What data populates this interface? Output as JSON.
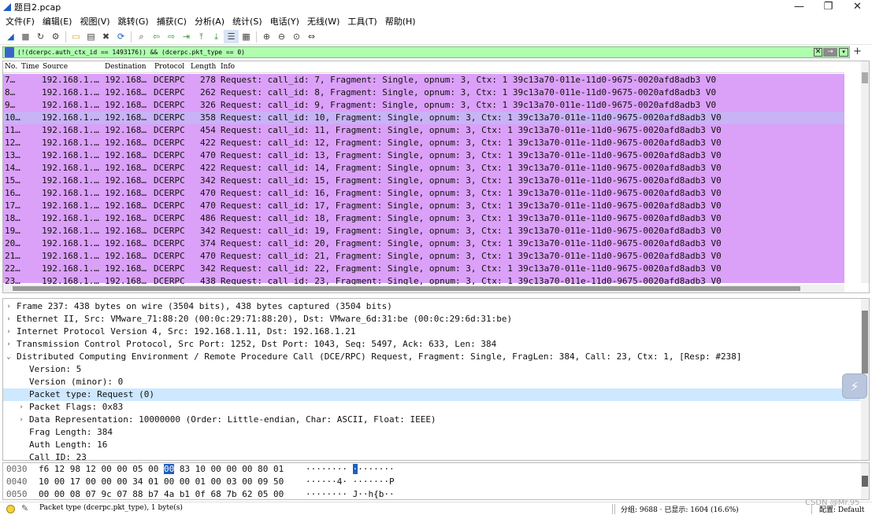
{
  "window": {
    "title": "题目2.pcap",
    "minimize_glyph": "—",
    "restore_glyph": "❐",
    "close_glyph": "✕"
  },
  "menu": [
    "文件(F)",
    "编辑(E)",
    "视图(V)",
    "跳转(G)",
    "捕获(C)",
    "分析(A)",
    "统计(S)",
    "电话(Y)",
    "无线(W)",
    "工具(T)",
    "帮助(H)"
  ],
  "toolbar_icons": [
    {
      "name": "shark-fin-start-icon",
      "glyph": "◢"
    },
    {
      "name": "stop-capture-icon",
      "glyph": "■"
    },
    {
      "name": "restart-capture-icon",
      "glyph": "↻"
    },
    {
      "name": "capture-options-icon",
      "glyph": "⚙"
    },
    {
      "name": "open-file-icon",
      "glyph": "▭"
    },
    {
      "name": "save-file-icon",
      "glyph": "▤"
    },
    {
      "name": "close-file-icon",
      "glyph": "✖"
    },
    {
      "name": "reload-file-icon",
      "glyph": "⟳"
    },
    {
      "name": "find-packet-icon",
      "glyph": "⌕"
    },
    {
      "name": "go-back-icon",
      "glyph": "⇦"
    },
    {
      "name": "go-forward-icon",
      "glyph": "⇨"
    },
    {
      "name": "go-to-packet-icon",
      "glyph": "⇥"
    },
    {
      "name": "go-first-icon",
      "glyph": "⤒"
    },
    {
      "name": "go-last-icon",
      "glyph": "⤓"
    },
    {
      "name": "auto-scroll-icon",
      "glyph": "☰"
    },
    {
      "name": "colorize-icon",
      "glyph": "▦"
    },
    {
      "name": "zoom-in-icon",
      "glyph": "⊕"
    },
    {
      "name": "zoom-out-icon",
      "glyph": "⊖"
    },
    {
      "name": "zoom-normal-icon",
      "glyph": "⊙"
    },
    {
      "name": "resize-columns-icon",
      "glyph": "⇔"
    }
  ],
  "filter": {
    "text": "(!(dcerpc.auth_ctx_id == 1493176)) && (dcerpc.pkt_type == 0)",
    "clear_glyph": "✕",
    "apply_glyph": "→",
    "dropdown_glyph": "▾",
    "add_glyph": "+"
  },
  "packet_list": {
    "columns": [
      "No.",
      "Time",
      "Source",
      "Destination",
      "Protocol",
      "Length",
      "Info"
    ],
    "rows": [
      {
        "no": "7…",
        "src": "192.168.1.…",
        "dst": "192.168…",
        "proto": "DCERPC",
        "len": "278",
        "info": "Request: call_id: 7, Fragment: Single, opnum: 3, Ctx: 1 39c13a70-011e-11d0-9675-0020afd8adb3 V0"
      },
      {
        "no": "8…",
        "src": "192.168.1.…",
        "dst": "192.168…",
        "proto": "DCERPC",
        "len": "262",
        "info": "Request: call_id: 8, Fragment: Single, opnum: 3, Ctx: 1 39c13a70-011e-11d0-9675-0020afd8adb3 V0"
      },
      {
        "no": "9…",
        "src": "192.168.1.…",
        "dst": "192.168…",
        "proto": "DCERPC",
        "len": "326",
        "info": "Request: call_id: 9, Fragment: Single, opnum: 3, Ctx: 1 39c13a70-011e-11d0-9675-0020afd8adb3 V0"
      },
      {
        "no": "10…",
        "src": "192.168.1.…",
        "dst": "192.168…",
        "proto": "DCERPC",
        "len": "358",
        "info": "Request: call_id: 10, Fragment: Single, opnum: 3, Ctx: 1 39c13a70-011e-11d0-9675-0020afd8adb3 V0"
      },
      {
        "no": "11…",
        "src": "192.168.1.…",
        "dst": "192.168…",
        "proto": "DCERPC",
        "len": "454",
        "info": "Request: call_id: 11, Fragment: Single, opnum: 3, Ctx: 1 39c13a70-011e-11d0-9675-0020afd8adb3 V0"
      },
      {
        "no": "12…",
        "src": "192.168.1.…",
        "dst": "192.168…",
        "proto": "DCERPC",
        "len": "422",
        "info": "Request: call_id: 12, Fragment: Single, opnum: 3, Ctx: 1 39c13a70-011e-11d0-9675-0020afd8adb3 V0"
      },
      {
        "no": "13…",
        "src": "192.168.1.…",
        "dst": "192.168…",
        "proto": "DCERPC",
        "len": "470",
        "info": "Request: call_id: 13, Fragment: Single, opnum: 3, Ctx: 1 39c13a70-011e-11d0-9675-0020afd8adb3 V0"
      },
      {
        "no": "14…",
        "src": "192.168.1.…",
        "dst": "192.168…",
        "proto": "DCERPC",
        "len": "422",
        "info": "Request: call_id: 14, Fragment: Single, opnum: 3, Ctx: 1 39c13a70-011e-11d0-9675-0020afd8adb3 V0"
      },
      {
        "no": "15…",
        "src": "192.168.1.…",
        "dst": "192.168…",
        "proto": "DCERPC",
        "len": "342",
        "info": "Request: call_id: 15, Fragment: Single, opnum: 3, Ctx: 1 39c13a70-011e-11d0-9675-0020afd8adb3 V0"
      },
      {
        "no": "16…",
        "src": "192.168.1.…",
        "dst": "192.168…",
        "proto": "DCERPC",
        "len": "470",
        "info": "Request: call_id: 16, Fragment: Single, opnum: 3, Ctx: 1 39c13a70-011e-11d0-9675-0020afd8adb3 V0"
      },
      {
        "no": "17…",
        "src": "192.168.1.…",
        "dst": "192.168…",
        "proto": "DCERPC",
        "len": "470",
        "info": "Request: call_id: 17, Fragment: Single, opnum: 3, Ctx: 1 39c13a70-011e-11d0-9675-0020afd8adb3 V0"
      },
      {
        "no": "18…",
        "src": "192.168.1.…",
        "dst": "192.168…",
        "proto": "DCERPC",
        "len": "486",
        "info": "Request: call_id: 18, Fragment: Single, opnum: 3, Ctx: 1 39c13a70-011e-11d0-9675-0020afd8adb3 V0"
      },
      {
        "no": "19…",
        "src": "192.168.1.…",
        "dst": "192.168…",
        "proto": "DCERPC",
        "len": "342",
        "info": "Request: call_id: 19, Fragment: Single, opnum: 3, Ctx: 1 39c13a70-011e-11d0-9675-0020afd8adb3 V0"
      },
      {
        "no": "20…",
        "src": "192.168.1.…",
        "dst": "192.168…",
        "proto": "DCERPC",
        "len": "374",
        "info": "Request: call_id: 20, Fragment: Single, opnum: 3, Ctx: 1 39c13a70-011e-11d0-9675-0020afd8adb3 V0"
      },
      {
        "no": "21…",
        "src": "192.168.1.…",
        "dst": "192.168…",
        "proto": "DCERPC",
        "len": "470",
        "info": "Request: call_id: 21, Fragment: Single, opnum: 3, Ctx: 1 39c13a70-011e-11d0-9675-0020afd8adb3 V0"
      },
      {
        "no": "22…",
        "src": "192.168.1.…",
        "dst": "192.168…",
        "proto": "DCERPC",
        "len": "342",
        "info": "Request: call_id: 22, Fragment: Single, opnum: 3, Ctx: 1 39c13a70-011e-11d0-9675-0020afd8adb3 V0"
      },
      {
        "no": "23…",
        "src": "192.168.1.…",
        "dst": "192.168…",
        "proto": "DCERPC",
        "len": "438",
        "info": "Request: call_id: 23, Fragment: Single, opnum: 3, Ctx: 1 39c13a70-011e-11d0-9675-0020afd8adb3 V0"
      }
    ],
    "selected_index": 3,
    "row_color": "#dba0f8",
    "selected_color": "#c7b3f5"
  },
  "details": {
    "rows": [
      {
        "indent": 0,
        "arrow": "›",
        "text": "Frame 237: 438 bytes on wire (3504 bits), 438 bytes captured (3504 bits)"
      },
      {
        "indent": 0,
        "arrow": "›",
        "text": "Ethernet II, Src: VMware_71:88:20 (00:0c:29:71:88:20), Dst: VMware_6d:31:be (00:0c:29:6d:31:be)"
      },
      {
        "indent": 0,
        "arrow": "›",
        "text": "Internet Protocol Version 4, Src: 192.168.1.11, Dst: 192.168.1.21"
      },
      {
        "indent": 0,
        "arrow": "›",
        "text": "Transmission Control Protocol, Src Port: 1252, Dst Port: 1043, Seq: 5497, Ack: 633, Len: 384"
      },
      {
        "indent": 0,
        "arrow": "⌄",
        "text": "Distributed Computing Environment / Remote Procedure Call (DCE/RPC) Request, Fragment: Single, FragLen: 384, Call: 23, Ctx: 1, [Resp: #238]"
      },
      {
        "indent": 1,
        "arrow": "",
        "text": "Version: 5"
      },
      {
        "indent": 1,
        "arrow": "",
        "text": "Version (minor): 0"
      },
      {
        "indent": 1,
        "arrow": "",
        "text": "Packet type: Request (0)"
      },
      {
        "indent": 1,
        "arrow": "›",
        "text": "Packet Flags: 0x83"
      },
      {
        "indent": 1,
        "arrow": "›",
        "text": "Data Representation: 10000000 (Order: Little-endian, Char: ASCII, Float: IEEE)"
      },
      {
        "indent": 1,
        "arrow": "",
        "text": "Frag Length: 384"
      },
      {
        "indent": 1,
        "arrow": "",
        "text": "Auth Length: 16"
      },
      {
        "indent": 1,
        "arrow": "",
        "text": "Call ID: 23"
      }
    ],
    "selected_index": 7,
    "selected_color": "#cde8ff"
  },
  "bytes": {
    "rows": [
      {
        "offset": "0030",
        "hex_pre": "f6 12 98 12 00 00 05 00 ",
        "hex_hl": "00",
        "hex_post": " 83 10 00 00 00 80 01",
        "ascii_pre": "········ ",
        "ascii_hl": "·",
        "ascii_post": "·······"
      },
      {
        "offset": "0040",
        "hex_pre": "10 00 17 00 00 00 34 01  00 00 01 00 03 00 09 50",
        "hex_hl": "",
        "hex_post": "",
        "ascii_pre": "······4· ·······P",
        "ascii_hl": "",
        "ascii_post": ""
      },
      {
        "offset": "0050",
        "hex_pre": "00 00 08 07 9c 07 88 b7  4a b1 0f 68 7b 62 05 00",
        "hex_hl": "",
        "hex_post": "",
        "ascii_pre": "········ J··h{b··",
        "ascii_hl": "",
        "ascii_post": ""
      }
    ],
    "highlight_color": "#1f5fbf"
  },
  "status": {
    "field_info": "Packet type (dcerpc.pkt_type), 1 byte(s)",
    "stats": "分组: 9688 · 已显示: 1604 (16.6%)",
    "profile": "配置: Default",
    "watermark": "CSDN @Mr.95",
    "indicator_color": "#f2d33b"
  }
}
